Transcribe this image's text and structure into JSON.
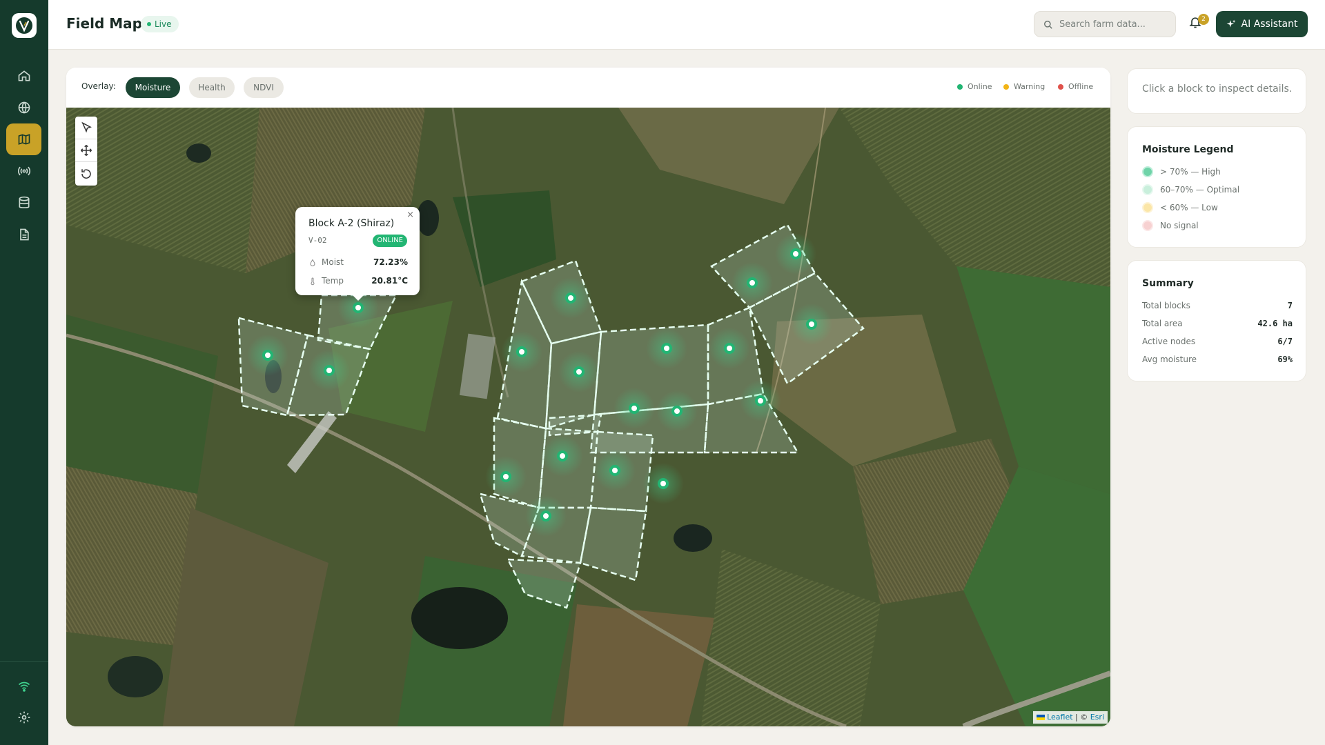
{
  "header": {
    "title": "Field Map",
    "live": "Live",
    "search_placeholder": "Search farm data...",
    "notification_count": "2",
    "ai_button": "AI Assistant"
  },
  "sidebar": {
    "items": [
      {
        "icon": "home-icon"
      },
      {
        "icon": "globe-icon"
      },
      {
        "icon": "map-icon",
        "active": true
      },
      {
        "icon": "sensor-icon"
      },
      {
        "icon": "database-icon"
      },
      {
        "icon": "report-icon"
      }
    ],
    "bottom": [
      {
        "icon": "wifi-icon"
      },
      {
        "icon": "gear-icon"
      }
    ]
  },
  "overlay": {
    "label": "Overlay:",
    "options": [
      "Moisture",
      "Health",
      "NDVI"
    ],
    "selected": "Moisture",
    "status": [
      {
        "label": "Online",
        "color": "#22b573"
      },
      {
        "label": "Warning",
        "color": "#f2b416"
      },
      {
        "label": "Offline",
        "color": "#e0524b"
      }
    ]
  },
  "popup": {
    "title": "Block A-2 (Shiraz)",
    "code": "V-02",
    "status": "ONLINE",
    "moisture_label": "Moist",
    "moisture_value": "72.23%",
    "temp_label": "Temp",
    "temp_value": "20.81°C",
    "close": "×"
  },
  "attribution": {
    "leaflet": "Leaflet",
    "sep": " | © ",
    "esri": "Esri"
  },
  "inspect": {
    "text": "Click a block to inspect details."
  },
  "legend": {
    "title": "Moisture Legend",
    "items": [
      {
        "label": "> 70% — High",
        "color": "#6fd3a8"
      },
      {
        "label": "60–70% — Optimal",
        "color": "#c9efdc"
      },
      {
        "label": "< 60% — Low",
        "color": "#fbe6a8"
      },
      {
        "label": "No signal",
        "color": "#f7d1d1"
      }
    ]
  },
  "summary": {
    "title": "Summary",
    "rows": [
      {
        "k": "Total blocks",
        "v": "7"
      },
      {
        "k": "Total area",
        "v": "42.6 ha"
      },
      {
        "k": "Active nodes",
        "v": "6/7"
      },
      {
        "k": "Avg moisture",
        "v": "69%"
      }
    ]
  },
  "colors": {
    "brand": "#153a2c",
    "accent": "#c9a227",
    "online": "#22b573"
  }
}
